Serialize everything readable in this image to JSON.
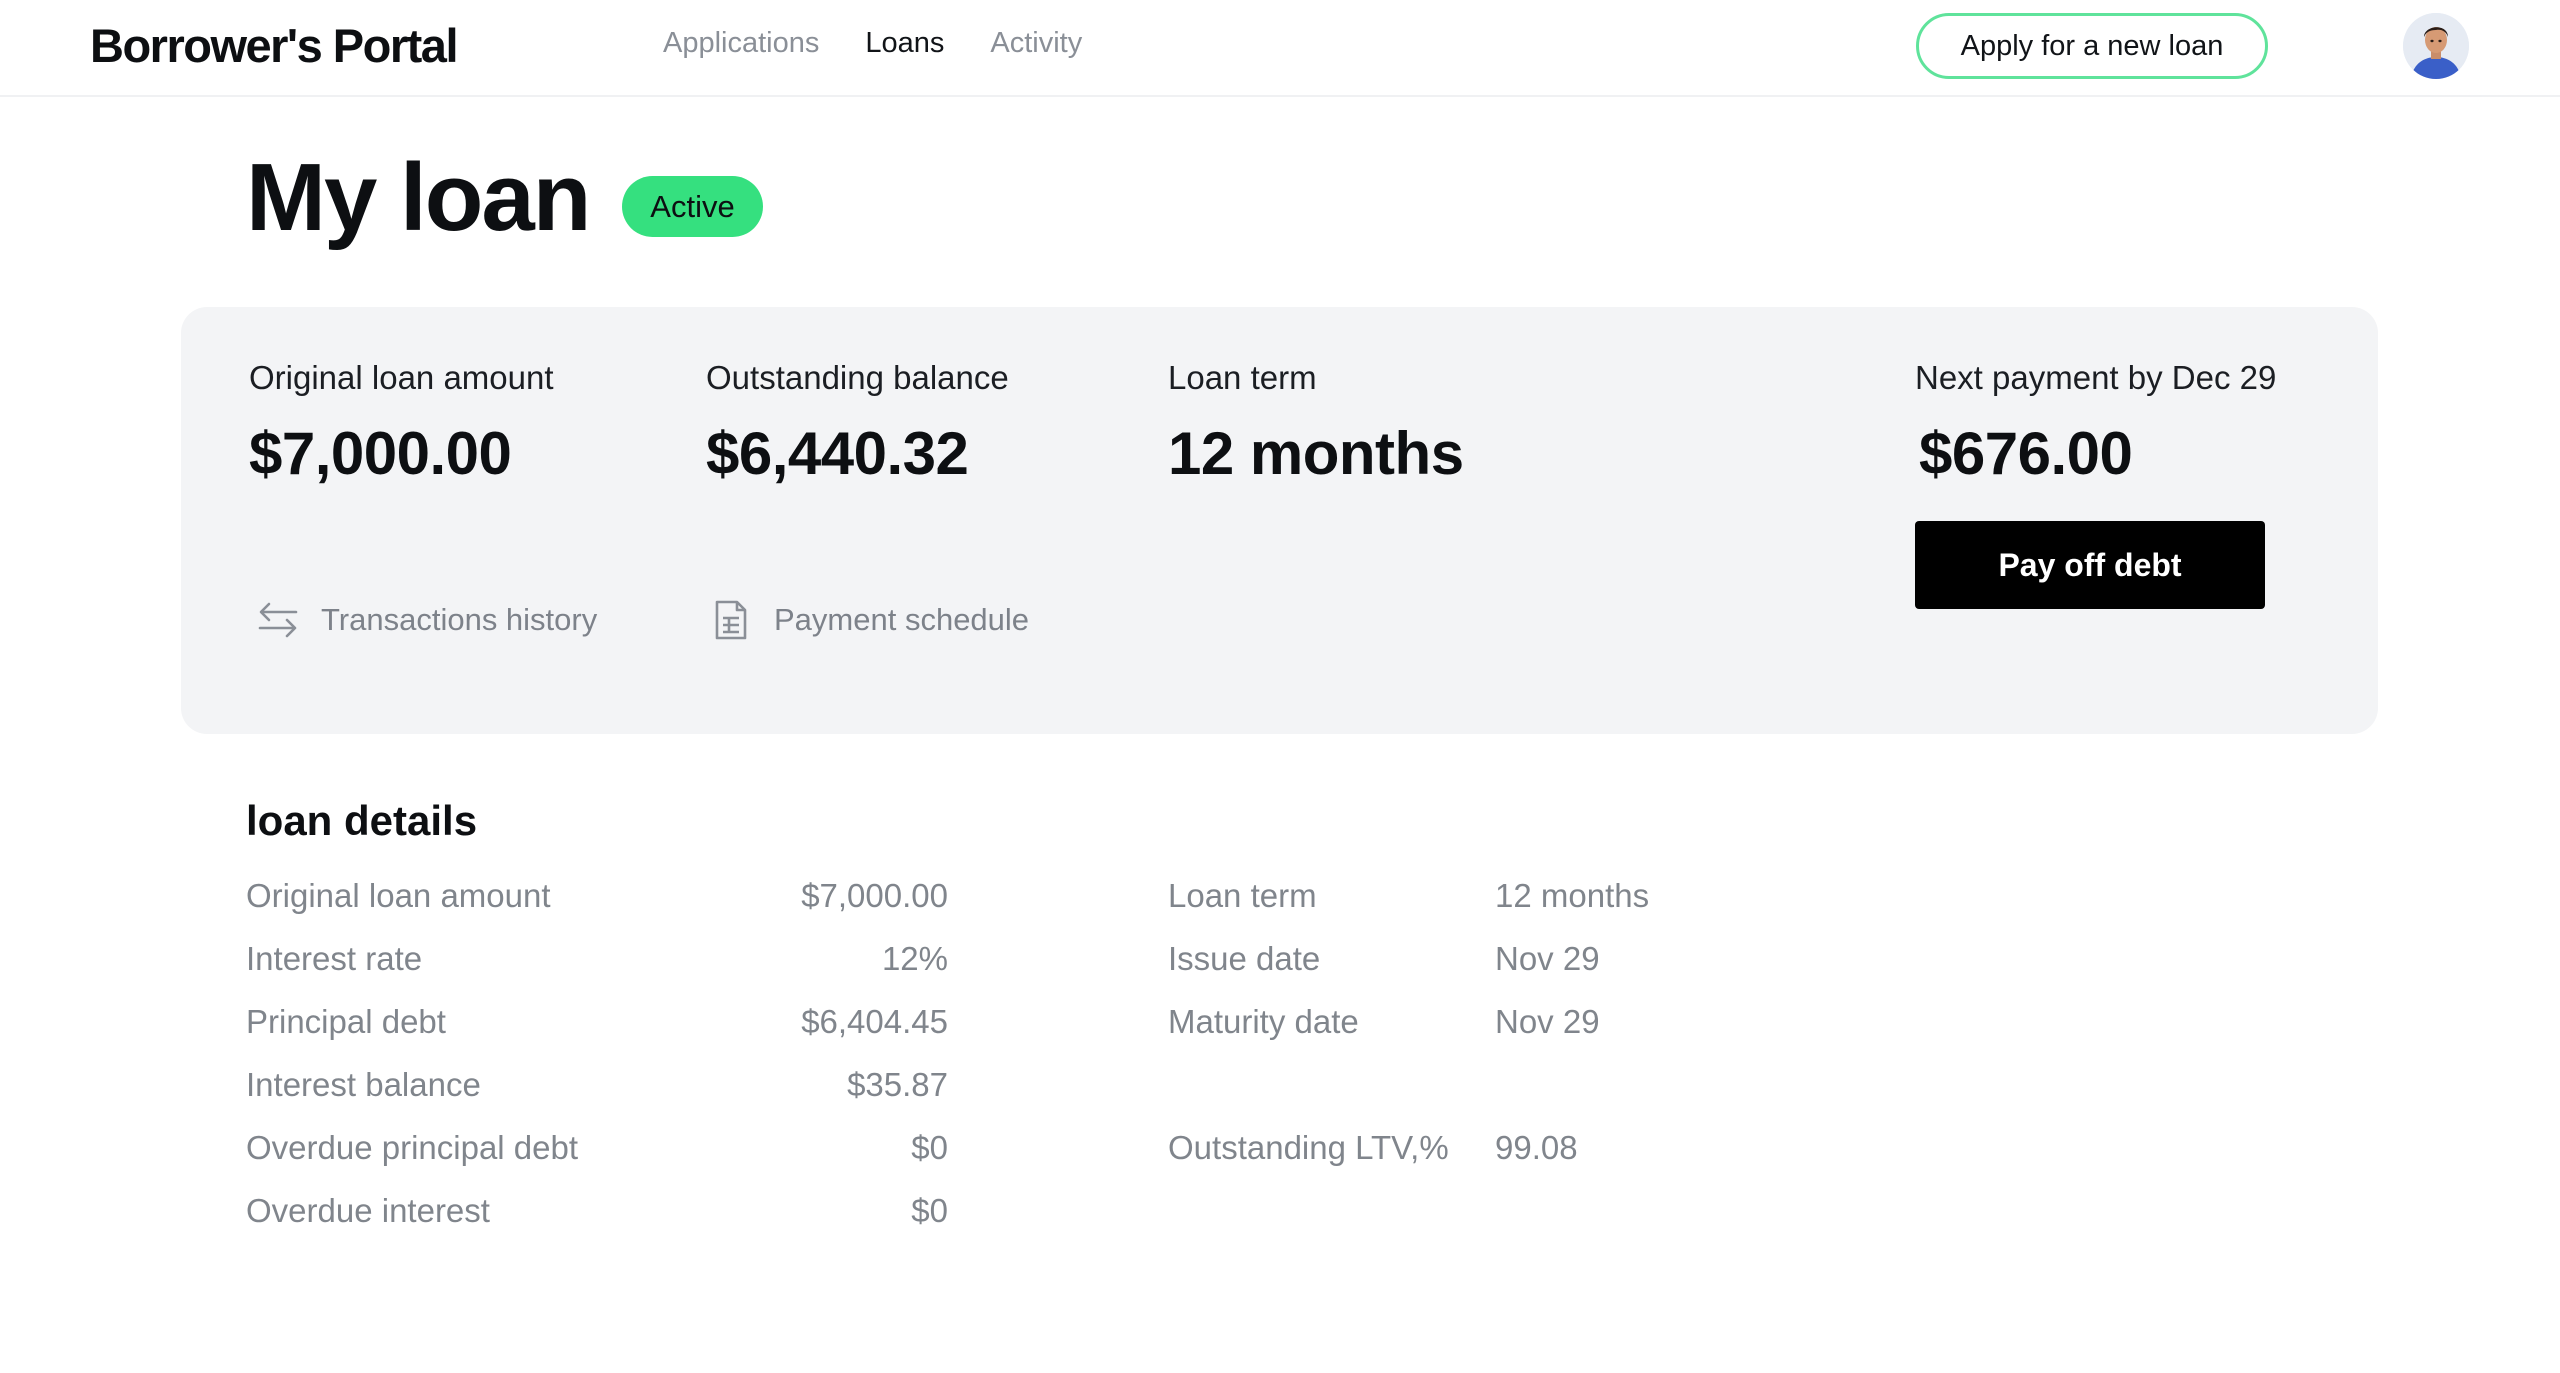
{
  "header": {
    "logo": "Borrower's Portal",
    "nav": [
      "Applications",
      "Loans",
      "Activity"
    ],
    "active_nav": "Loans",
    "apply_button": "Apply for a new loan"
  },
  "page": {
    "title": "My loan",
    "status": "Active"
  },
  "summary": {
    "original_amount": {
      "label": "Original loan amount",
      "value": "$7,000.00"
    },
    "outstanding_balance": {
      "label": "Outstanding balance",
      "value": "$6,440.32"
    },
    "loan_term": {
      "label": "Loan term",
      "value": "12 months"
    },
    "next_payment": {
      "label": "Next payment by Dec 29",
      "value": "$676.00"
    },
    "payoff_button": "Pay off debt",
    "transactions_link": "Transactions history",
    "schedule_link": "Payment schedule"
  },
  "details": {
    "title": "loan details",
    "left": [
      {
        "label": "Original loan amount",
        "value": "$7,000.00"
      },
      {
        "label": "Interest rate",
        "value": "12%"
      },
      {
        "label": "Principal debt",
        "value": "$6,404.45"
      },
      {
        "label": "Interest balance",
        "value": "$35.87"
      },
      {
        "label": "Overdue principal debt",
        "value": "$0"
      },
      {
        "label": "Overdue interest",
        "value": "$0"
      }
    ],
    "right": [
      {
        "label": "Loan term",
        "value": "12 months"
      },
      {
        "label": "Issue date",
        "value": "Nov 29"
      },
      {
        "label": "Maturity date",
        "value": "Nov 29"
      },
      {
        "label": "Outstanding LTV,%",
        "value": "99.08"
      }
    ]
  },
  "icons": {
    "transactions": "arrows-swap-icon",
    "schedule": "document-icon"
  },
  "colors": {
    "accent_green": "#35e07f",
    "apply_border": "#5fe39b",
    "card_bg": "#f3f4f6",
    "primary_button": "#000000"
  }
}
